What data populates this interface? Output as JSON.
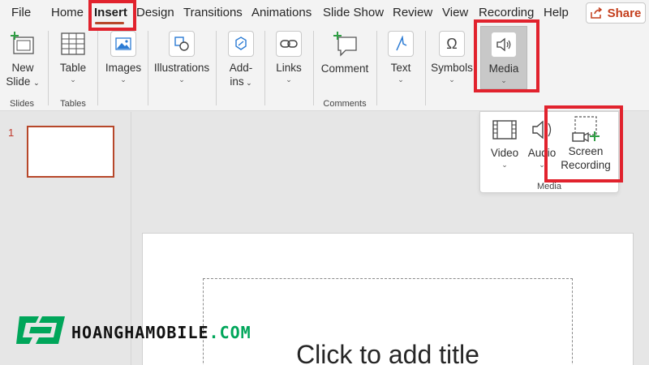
{
  "menu": {
    "file": "File",
    "home": "Home",
    "insert": "Insert",
    "design": "Design",
    "transitions": "Transitions",
    "animations": "Animations",
    "slide_show": "Slide Show",
    "review": "Review",
    "view": "View",
    "recording": "Recording",
    "help": "Help",
    "share": "Share"
  },
  "ribbon": {
    "new_slide": [
      "New",
      "Slide"
    ],
    "table": "Table",
    "images": "Images",
    "illustrations": "Illustrations",
    "addins": [
      "Add-",
      "ins"
    ],
    "links": "Links",
    "comment": "Comment",
    "text": "Text",
    "symbols": "Symbols",
    "media": "Media",
    "groups": {
      "slides": "Slides",
      "tables": "Tables",
      "comments": "Comments"
    }
  },
  "media_menu": {
    "video": "Video",
    "audio": "Audio",
    "screen_recording": [
      "Screen",
      "Recording"
    ],
    "group_label": "Media"
  },
  "slides_panel": {
    "slide_number": "1"
  },
  "slide": {
    "title_placeholder": "Click to add title"
  },
  "watermark": {
    "brand_main": "HOANGHAMOBILE",
    "brand_suffix": ".COM"
  },
  "colors": {
    "accent": "#b7472a",
    "highlight": "#e1222d",
    "brand_green": "#00a65a"
  }
}
